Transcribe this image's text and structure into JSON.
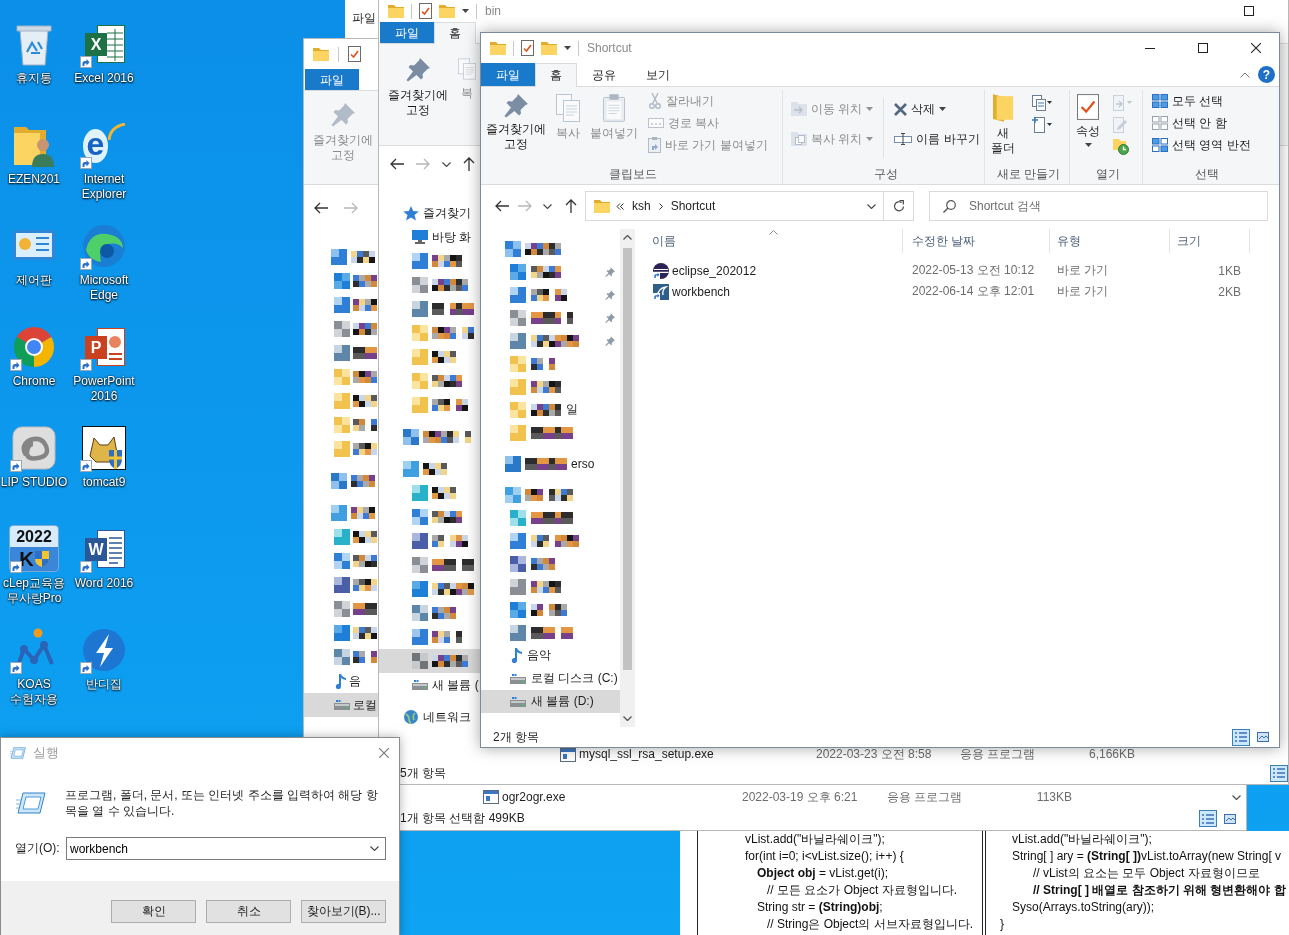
{
  "desktop": {
    "icons": [
      {
        "label": "휴지통",
        "shortcut": false
      },
      {
        "label": "EZEN201",
        "shortcut": false
      },
      {
        "label": "제어판",
        "shortcut": false
      },
      {
        "label": "Chrome",
        "shortcut": true
      },
      {
        "label": "LIP STUDIO",
        "shortcut": true
      },
      {
        "label": "cLep교육용 무사랑Pro",
        "shortcut": true,
        "logo_text": [
          "2022",
          "K"
        ]
      },
      {
        "label": "KOAS 수험자용",
        "shortcut": true
      },
      {
        "label": "Excel 2016",
        "shortcut": true,
        "logo_text": [
          "X"
        ]
      },
      {
        "label": "Internet Explorer",
        "shortcut": true,
        "logo_text": [
          "e"
        ]
      },
      {
        "label": "Microsoft Edge",
        "shortcut": true
      },
      {
        "label": "PowerPoint 2016",
        "shortcut": true,
        "logo_text": [
          "P"
        ]
      },
      {
        "label": "tomcat9",
        "shortcut": true
      },
      {
        "label": "Word 2016",
        "shortcut": true,
        "logo_text": [
          "W"
        ]
      },
      {
        "label": "반디집",
        "shortcut": true
      }
    ]
  },
  "window_back": {
    "file_tab": "파일"
  },
  "window_lower": {
    "file_tab": "파일",
    "pin_button": {
      "label": "즐겨찾기에 고정",
      "disabled": true
    },
    "nav_tree": [
      {
        "kind": "star",
        "pixelated": true,
        "selected": false,
        "children": [
          {
            "kind": "desktop",
            "pixelated": true,
            "selected": false
          },
          {
            "kind": "download",
            "pixelated": true,
            "selected": false
          },
          {
            "kind": "docs",
            "pixelated": true,
            "selected": false
          },
          {
            "kind": "pictures",
            "pixelated": true,
            "selected": false
          },
          {
            "kind": "folder",
            "pixelated": true,
            "selected": false
          },
          {
            "kind": "folder",
            "pixelated": true,
            "selected": false
          },
          {
            "kind": "folder",
            "pixelated": true,
            "selected": false
          },
          {
            "kind": "folder",
            "pixelated": true,
            "selected": false
          }
        ]
      },
      {
        "kind": "cloud",
        "pixelated": true,
        "selected": false
      },
      {
        "kind": "pc",
        "pixelated": true,
        "selected": false,
        "children": [
          {
            "kind": "objects",
            "pixelated": true,
            "selected": false
          },
          {
            "kind": "download",
            "pixelated": true,
            "selected": false
          },
          {
            "kind": "video",
            "pixelated": true,
            "selected": false
          },
          {
            "kind": "docs",
            "pixelated": true,
            "selected": false
          },
          {
            "kind": "desktop",
            "pixelated": true,
            "selected": false
          },
          {
            "kind": "pictures",
            "pixelated": true,
            "selected": false
          },
          {
            "kind": "music",
            "pixelated": false,
            "label": "음",
            "selected": false
          },
          {
            "kind": "drive",
            "pixelated": false,
            "label": "로컬",
            "selected": true
          }
        ]
      }
    ],
    "rows": [
      {
        "name": "ogr2ogr.exe",
        "modified": "2022-03-19 오후 6:21",
        "type": "응용 프로그램",
        "size": "113KB"
      }
    ],
    "status": "1개 항목 선택함 499KB",
    "view_buttons": [
      {
        "selected": true
      },
      {
        "selected": false
      }
    ]
  },
  "window_bin": {
    "title": "bin",
    "tabs": [
      {
        "label": "파일",
        "kind": "file",
        "selected": false
      },
      {
        "label": "홈",
        "kind": "tab",
        "selected": true
      }
    ],
    "ribbon_buttons": [
      {
        "label": "즐겨찾기에 고정",
        "disabled": false
      },
      {
        "label": "복",
        "disabled": true
      }
    ],
    "nav_tree": [
      {
        "kind": "star",
        "pixelated": false,
        "label": "즐겨찾기",
        "selected": false,
        "children": [
          {
            "kind": "desktop",
            "pixelated": false,
            "label": "바탕 화",
            "selected": false
          },
          {
            "kind": "download",
            "pixelated": true,
            "selected": false
          },
          {
            "kind": "docs",
            "pixelated": true,
            "selected": false
          },
          {
            "kind": "pictures",
            "pixelated": true,
            "selected": false
          },
          {
            "kind": "folder",
            "pixelated": true,
            "selected": false
          },
          {
            "kind": "folder",
            "pixelated": true,
            "selected": false
          },
          {
            "kind": "folder",
            "pixelated": true,
            "selected": false
          },
          {
            "kind": "folder",
            "pixelated": true,
            "selected": false
          }
        ]
      },
      {
        "kind": "cloud",
        "pixelated": true,
        "selected": false
      },
      {
        "kind": "pc",
        "pixelated": true,
        "selected": false,
        "children": [
          {
            "kind": "objects",
            "pixelated": true,
            "selected": false
          },
          {
            "kind": "download",
            "pixelated": true,
            "selected": false
          },
          {
            "kind": "video",
            "pixelated": true,
            "selected": false
          },
          {
            "kind": "docs",
            "pixelated": true,
            "selected": false
          },
          {
            "kind": "desktop",
            "pixelated": true,
            "selected": false
          },
          {
            "kind": "pictures",
            "pixelated": true,
            "selected": false
          },
          {
            "kind": "music",
            "pixelated": true,
            "selected": false
          },
          {
            "kind": "drive",
            "pixelated": true,
            "selected": true
          },
          {
            "kind": "drive",
            "pixelated": false,
            "label": "새 볼륨 (",
            "selected": false
          }
        ]
      },
      {
        "kind": "network",
        "pixelated": false,
        "label": "네트워크",
        "selected": false
      }
    ],
    "rows": [
      {
        "name": "mysql_ssl_rsa_setup.exe",
        "modified": "2022-03-23 오전 8:58",
        "type": "응용 프로그램",
        "size": "6,166KB"
      }
    ],
    "status": "5개 항목",
    "view_buttons": [
      {
        "selected": true
      }
    ]
  },
  "window_shortcut": {
    "title": "Shortcut",
    "tabs": [
      {
        "label": "파일",
        "kind": "file",
        "selected": false
      },
      {
        "label": "홈",
        "kind": "tab",
        "selected": true
      },
      {
        "label": "공유",
        "kind": "tab",
        "selected": false
      },
      {
        "label": "보기",
        "kind": "tab",
        "selected": false
      }
    ],
    "help": "?",
    "ribbon": [
      {
        "kind": "clipboard",
        "label": "클립보드",
        "buttons": [
          {
            "label": "즐겨찾기에 고정",
            "disabled": false
          },
          {
            "label": "복사",
            "disabled": true
          },
          {
            "label": "붙여넣기",
            "disabled": true
          },
          {
            "label": "잘라내기",
            "disabled": true
          },
          {
            "label": "경로 복사",
            "disabled": true
          },
          {
            "label": "바로 가기 붙여넣기",
            "disabled": true
          }
        ]
      },
      {
        "kind": "organize",
        "label": "구성",
        "buttons": [
          {
            "label": "이동 위치",
            "disabled": true,
            "dropdown": true
          },
          {
            "label": "복사 위치",
            "disabled": true,
            "dropdown": true
          },
          {
            "label": "삭제",
            "disabled": false,
            "dropdown": true
          },
          {
            "label": "이름 바꾸기",
            "disabled": false,
            "dropdown": false
          }
        ]
      },
      {
        "kind": "new",
        "label": "새로 만들기",
        "buttons": [
          {
            "label": "새 폴더",
            "disabled": false
          }
        ]
      },
      {
        "kind": "open",
        "label": "열기",
        "buttons": [
          {
            "label": "속성",
            "disabled": false,
            "dropdown": true
          }
        ]
      },
      {
        "kind": "select",
        "label": "선택",
        "buttons": [
          {
            "label": "모두 선택",
            "disabled": false
          },
          {
            "label": "선택 안 함",
            "disabled": false
          },
          {
            "label": "선택 영역 반전",
            "disabled": false
          }
        ]
      }
    ],
    "address": [
      "ksh",
      "Shortcut"
    ],
    "search": {
      "placeholder": "Shortcut 검색"
    },
    "nav_tree": [
      {
        "kind": "star",
        "pixelated": true,
        "selected": false,
        "children": [
          {
            "kind": "desktop",
            "pixelated": true,
            "selected": false,
            "pinned": true
          },
          {
            "kind": "download",
            "pixelated": true,
            "selected": false,
            "pinned": true
          },
          {
            "kind": "docs",
            "pixelated": true,
            "selected": false,
            "pinned": true
          },
          {
            "kind": "pictures",
            "pixelated": true,
            "selected": false,
            "pinned": true
          },
          {
            "kind": "folder",
            "pixelated": true,
            "selected": false,
            "pinned": false
          },
          {
            "kind": "folder",
            "pixelated": true,
            "selected": false,
            "pinned": false
          },
          {
            "kind": "folder",
            "pixelated": true,
            "selected": false,
            "pinned": false,
            "tail": "일"
          },
          {
            "kind": "folder",
            "pixelated": true,
            "selected": false,
            "pinned": false
          }
        ]
      },
      {
        "kind": "cloud",
        "pixelated": true,
        "selected": false,
        "tail": "erso"
      },
      {
        "kind": "pc",
        "pixelated": true,
        "selected": false,
        "children": [
          {
            "kind": "objects",
            "pixelated": true,
            "selected": false
          },
          {
            "kind": "download",
            "pixelated": true,
            "selected": false
          },
          {
            "kind": "video",
            "pixelated": true,
            "selected": false
          },
          {
            "kind": "docs",
            "pixelated": true,
            "selected": false
          },
          {
            "kind": "desktop",
            "pixelated": true,
            "selected": false
          },
          {
            "kind": "pictures",
            "pixelated": true,
            "selected": false
          },
          {
            "kind": "music",
            "pixelated": false,
            "label": "음악",
            "selected": false
          },
          {
            "kind": "drive",
            "pixelated": false,
            "label": "로컬 디스크 (C:)",
            "selected": false
          },
          {
            "kind": "drive",
            "pixelated": false,
            "label": "새 볼륨 (D:)",
            "selected": true
          }
        ]
      }
    ],
    "columns": [
      {
        "label": "이름",
        "sorted": true
      },
      {
        "label": "수정한 날짜",
        "sorted": false
      },
      {
        "label": "유형",
        "sorted": false
      },
      {
        "label": "크기",
        "sorted": false
      }
    ],
    "rows": [
      {
        "name": "eclipse_202012",
        "modified": "2022-05-13 오전 10:12",
        "type": "바로 가기",
        "size": "1KB"
      },
      {
        "name": "workbench",
        "modified": "2022-06-14 오후 12:01",
        "type": "바로 가기",
        "size": "2KB"
      }
    ],
    "status": "2개 항목",
    "view_buttons": [
      {
        "selected": true
      },
      {
        "selected": false
      }
    ]
  },
  "run_dialog": {
    "title": "실행",
    "message": "프로그램, 폴더, 문서, 또는 인터넷 주소를 입력하여 해당 항목을 열 수 있습니다.",
    "open_label": "열기(O):",
    "value": "workbench",
    "buttons": [
      "확인",
      "취소",
      "찾아보기(B)..."
    ]
  },
  "document": {
    "boxes": [
      {
        "lines": [
          {
            "text": "vList.add(\"바닐라쉐이크\");"
          },
          {
            "text": "for(int i=0; i<vList.size(); i++) {",
            "children": [
              {
                "text": "**Object obj** = vList.get(i);",
                "children": [
                  {
                    "text": "// 모든 요소가 Object 자료형입니다."
                  }
                ]
              },
              {
                "text": "String str = **(String)obj**;",
                "children": [
                  {
                    "text": "// String은 Object의 서브자료형입니다."
                  }
                ]
              }
            ]
          }
        ]
      },
      {
        "lines": [
          {
            "text": "vList.add(\"바닐라쉐이크\");"
          },
          {
            "text": "String[ ] ary = **(String[ ])**vList.toArray(new String[ v",
            "children": [
              {
                "text": "// vList의 요소는 모두 Object 자료형이므로",
                "bold": false
              },
              {
                "text": "// String[ ] 배열로 참조하기 위해 형변환해야 합",
                "bold": true
              }
            ]
          },
          {
            "text": "Syso(Arrays.toString(ary));"
          }
        ],
        "closing": "}"
      }
    ]
  }
}
